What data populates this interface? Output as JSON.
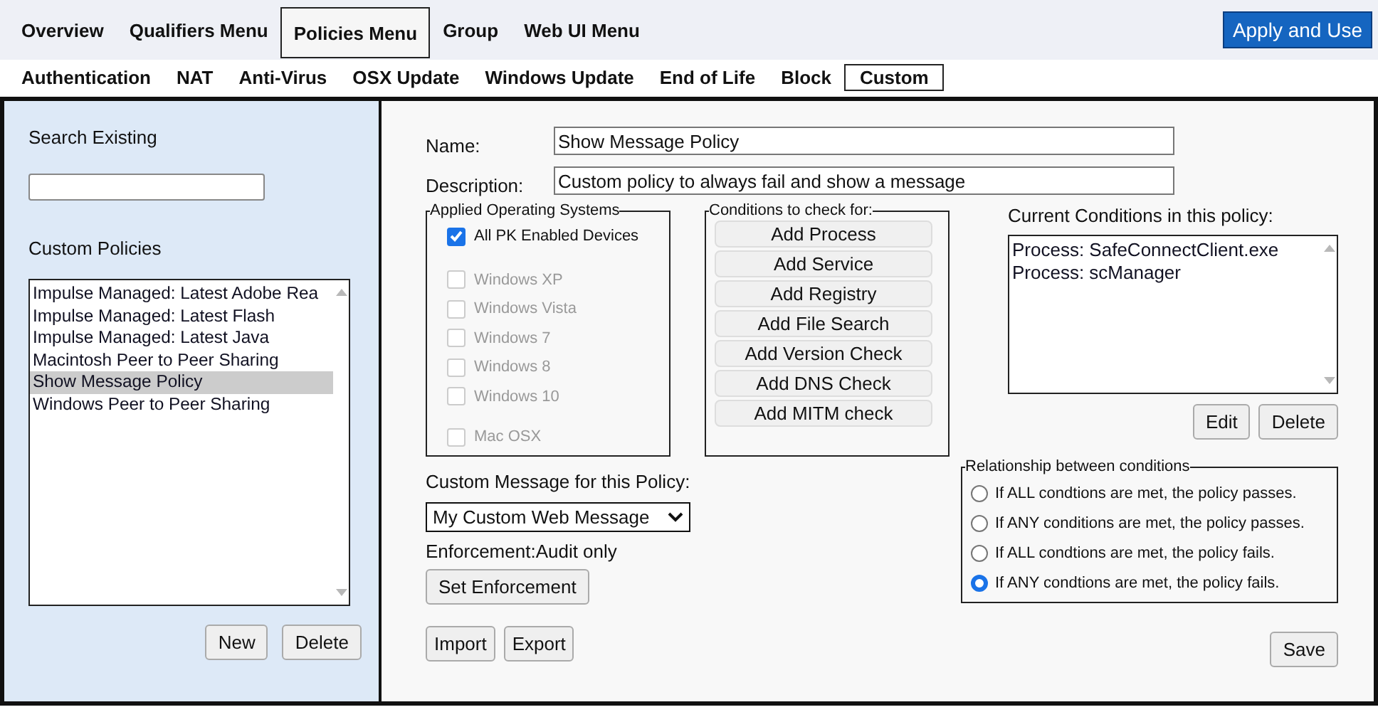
{
  "top_menu": [
    {
      "label": "Overview",
      "selected": false
    },
    {
      "label": "Qualifiers Menu",
      "selected": false
    },
    {
      "label": "Policies Menu",
      "selected": true
    },
    {
      "label": "Group",
      "selected": false
    },
    {
      "label": "Web UI Menu",
      "selected": false
    }
  ],
  "apply_button": "Apply and Use",
  "sub_menu": [
    {
      "label": "Authentication",
      "selected": false
    },
    {
      "label": "NAT",
      "selected": false
    },
    {
      "label": "Anti-Virus",
      "selected": false
    },
    {
      "label": "OSX Update",
      "selected": false
    },
    {
      "label": "Windows Update",
      "selected": false
    },
    {
      "label": "End of Life",
      "selected": false
    },
    {
      "label": "Block",
      "selected": false
    },
    {
      "label": "Custom",
      "selected": true
    }
  ],
  "sidebar": {
    "search_label": "Search Existing",
    "list_label": "Custom Policies",
    "policies": [
      {
        "label": "Impulse Managed: Latest Adobe Rea",
        "selected": false
      },
      {
        "label": "Impulse Managed: Latest Flash",
        "selected": false
      },
      {
        "label": "Impulse Managed: Latest Java",
        "selected": false
      },
      {
        "label": "Macintosh Peer to Peer Sharing",
        "selected": false
      },
      {
        "label": "Show Message Policy",
        "selected": true
      },
      {
        "label": "Windows Peer to Peer Sharing",
        "selected": false
      }
    ],
    "buttons": [
      "New",
      "Delete"
    ]
  },
  "form": {
    "name_label": "Name:",
    "name_value": "Show Message Policy",
    "description_label": "Description:",
    "description_value": "Custom policy to always fail and show a message",
    "os_legend": "Applied Operating Systems",
    "all_devices": {
      "label": "All PK Enabled Devices",
      "checked": true
    },
    "systems": [
      {
        "label": "Windows XP",
        "checked": false,
        "disabled": true
      },
      {
        "label": "Windows Vista",
        "checked": false,
        "disabled": true
      },
      {
        "label": "Windows 7",
        "checked": false,
        "disabled": true
      },
      {
        "label": "Windows 8",
        "checked": false,
        "disabled": true
      },
      {
        "label": "Windows 10",
        "checked": false,
        "disabled": true
      },
      {
        "label": "Mac OSX",
        "checked": false,
        "disabled": true
      }
    ],
    "conditions_legend": "Conditions to check for:",
    "condition_buttons": [
      "Add Process",
      "Add Service",
      "Add Registry",
      "Add File Search",
      "Add Version Check",
      "Add DNS Check",
      "Add MITM check"
    ],
    "current_label": "Current Conditions in this policy:",
    "current_conditions": [
      "Process: SafeConnectClient.exe",
      "Process: scManager"
    ],
    "condition_actions": [
      "Edit",
      "Delete"
    ],
    "message_label": "Custom Message for this Policy:",
    "message_value": "My Custom Web Message",
    "enforcement": "Enforcement:Audit only",
    "enforcement_button": "Set Enforcement",
    "relationship_legend": "Relationship between conditions",
    "relationships": [
      {
        "label": "If ALL condtions are met, the policy passes.",
        "selected": false
      },
      {
        "label": "If ANY conditions are met, the policy passes.",
        "selected": false
      },
      {
        "label": "If ALL condtions are met, the policy fails.",
        "selected": false
      },
      {
        "label": "If ANY condtions are met, the policy fails.",
        "selected": true
      }
    ],
    "bottom_buttons": [
      "Import",
      "Export"
    ],
    "save_button": "Save"
  }
}
